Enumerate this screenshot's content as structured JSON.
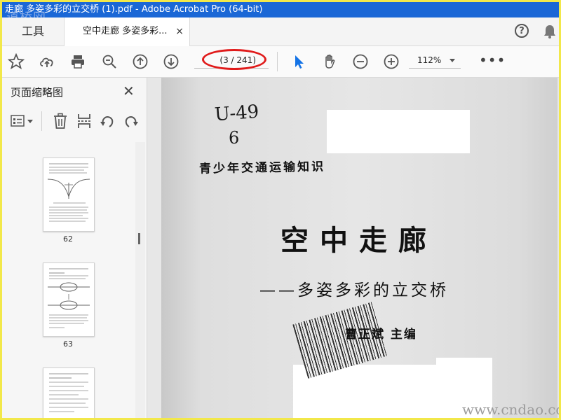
{
  "window": {
    "title": "走廊  多姿多彩的立交桥 (1).pdf - Adobe Acrobat Pro (64-bit)"
  },
  "watermark_top_left": "道桥网",
  "watermark_bottom_right": "www.cndao.com",
  "tabs": {
    "tools_label": "工具",
    "doc_label": "空中走廊  多姿多彩...",
    "close_glyph": "×",
    "help_glyph": "?"
  },
  "toolbar": {
    "page_indicator": "(3 / 241)",
    "zoom_value": "112%",
    "more_glyph": "•••",
    "icons": [
      "star-icon",
      "cloud-upload-icon",
      "print-icon",
      "zoom-out-magnifier-icon",
      "page-up-icon",
      "page-down-icon",
      "select-arrow-icon",
      "hand-tool-icon",
      "zoom-minus-icon",
      "zoom-plus-icon",
      "more-icon"
    ],
    "accent_color": "#1473e6",
    "highlight_color": "#e01b1b"
  },
  "sidebar": {
    "title": "页面缩略图",
    "close_glyph": "✕",
    "thumbnails": [
      {
        "label": "62"
      },
      {
        "label": "63"
      },
      {
        "label": ""
      }
    ]
  },
  "document": {
    "handwritten_code": "U-49",
    "handwritten_number": "6",
    "series_title": "青少年交通运输知识",
    "main_title": "空中走廊",
    "subtitle": "——多姿多彩的立交桥",
    "editor": "曹正斌  主编"
  }
}
